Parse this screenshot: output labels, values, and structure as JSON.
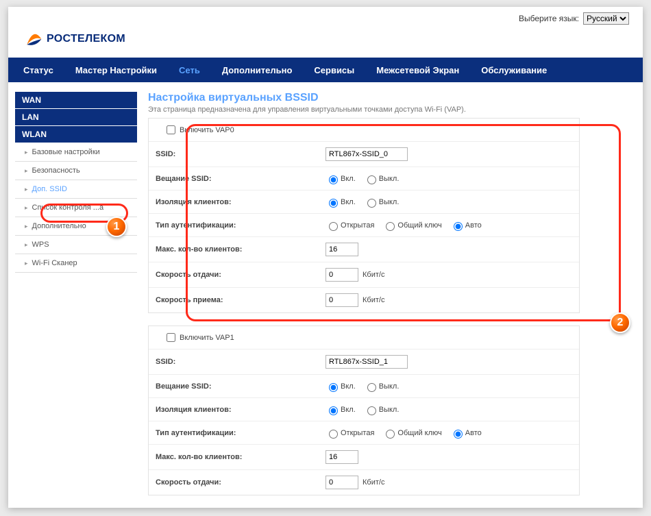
{
  "lang": {
    "label": "Выберите язык:",
    "value": "Русский"
  },
  "brand": "РОСТЕЛЕКОМ",
  "nav": {
    "status": "Статус",
    "wizard": "Мастер Настройки",
    "network": "Сеть",
    "advanced": "Дополнительно",
    "services": "Сервисы",
    "firewall": "Межсетевой Экран",
    "maintenance": "Обслуживание"
  },
  "sidebar": {
    "headers": {
      "wan": "WAN",
      "lan": "LAN",
      "wlan": "WLAN"
    },
    "items": {
      "basic": "Базовые настройки",
      "security": "Безопасность",
      "addssid": "Доп. SSID",
      "acl": "Список контроля ...а",
      "advanced": "Дополнительно",
      "wps": "WPS",
      "scanner": "Wi-Fi Сканер"
    }
  },
  "page": {
    "title": "Настройка виртуальных BSSID",
    "desc": "Эта страница предназначена для управления виртуальными точками доступа Wi-Fi (VAP)."
  },
  "labels": {
    "ssid": "SSID:",
    "broadcast": "Вещание SSID:",
    "isolation": "Изоляция клиентов:",
    "auth": "Тип аутентификации:",
    "maxclients": "Макс. кол-во клиентов:",
    "txrate": "Скорость отдачи:",
    "rxrate": "Скорость приема:",
    "on": "Вкл.",
    "off": "Выкл.",
    "open": "Открытая",
    "shared": "Общий ключ",
    "auto": "Авто",
    "unit": "Кбит/с"
  },
  "vap0": {
    "enable_label": "Включить VAP0",
    "ssid": "RTL867x-SSID_0",
    "broadcast": "on",
    "isolation": "on",
    "auth": "auto",
    "maxclients": "16",
    "tx": "0",
    "rx": "0"
  },
  "vap1": {
    "enable_label": "Включить VAP1",
    "ssid": "RTL867x-SSID_1",
    "broadcast": "on",
    "isolation": "on",
    "auth": "auto",
    "maxclients": "16",
    "tx": "0"
  },
  "markers": {
    "m1": "1",
    "m2": "2"
  }
}
